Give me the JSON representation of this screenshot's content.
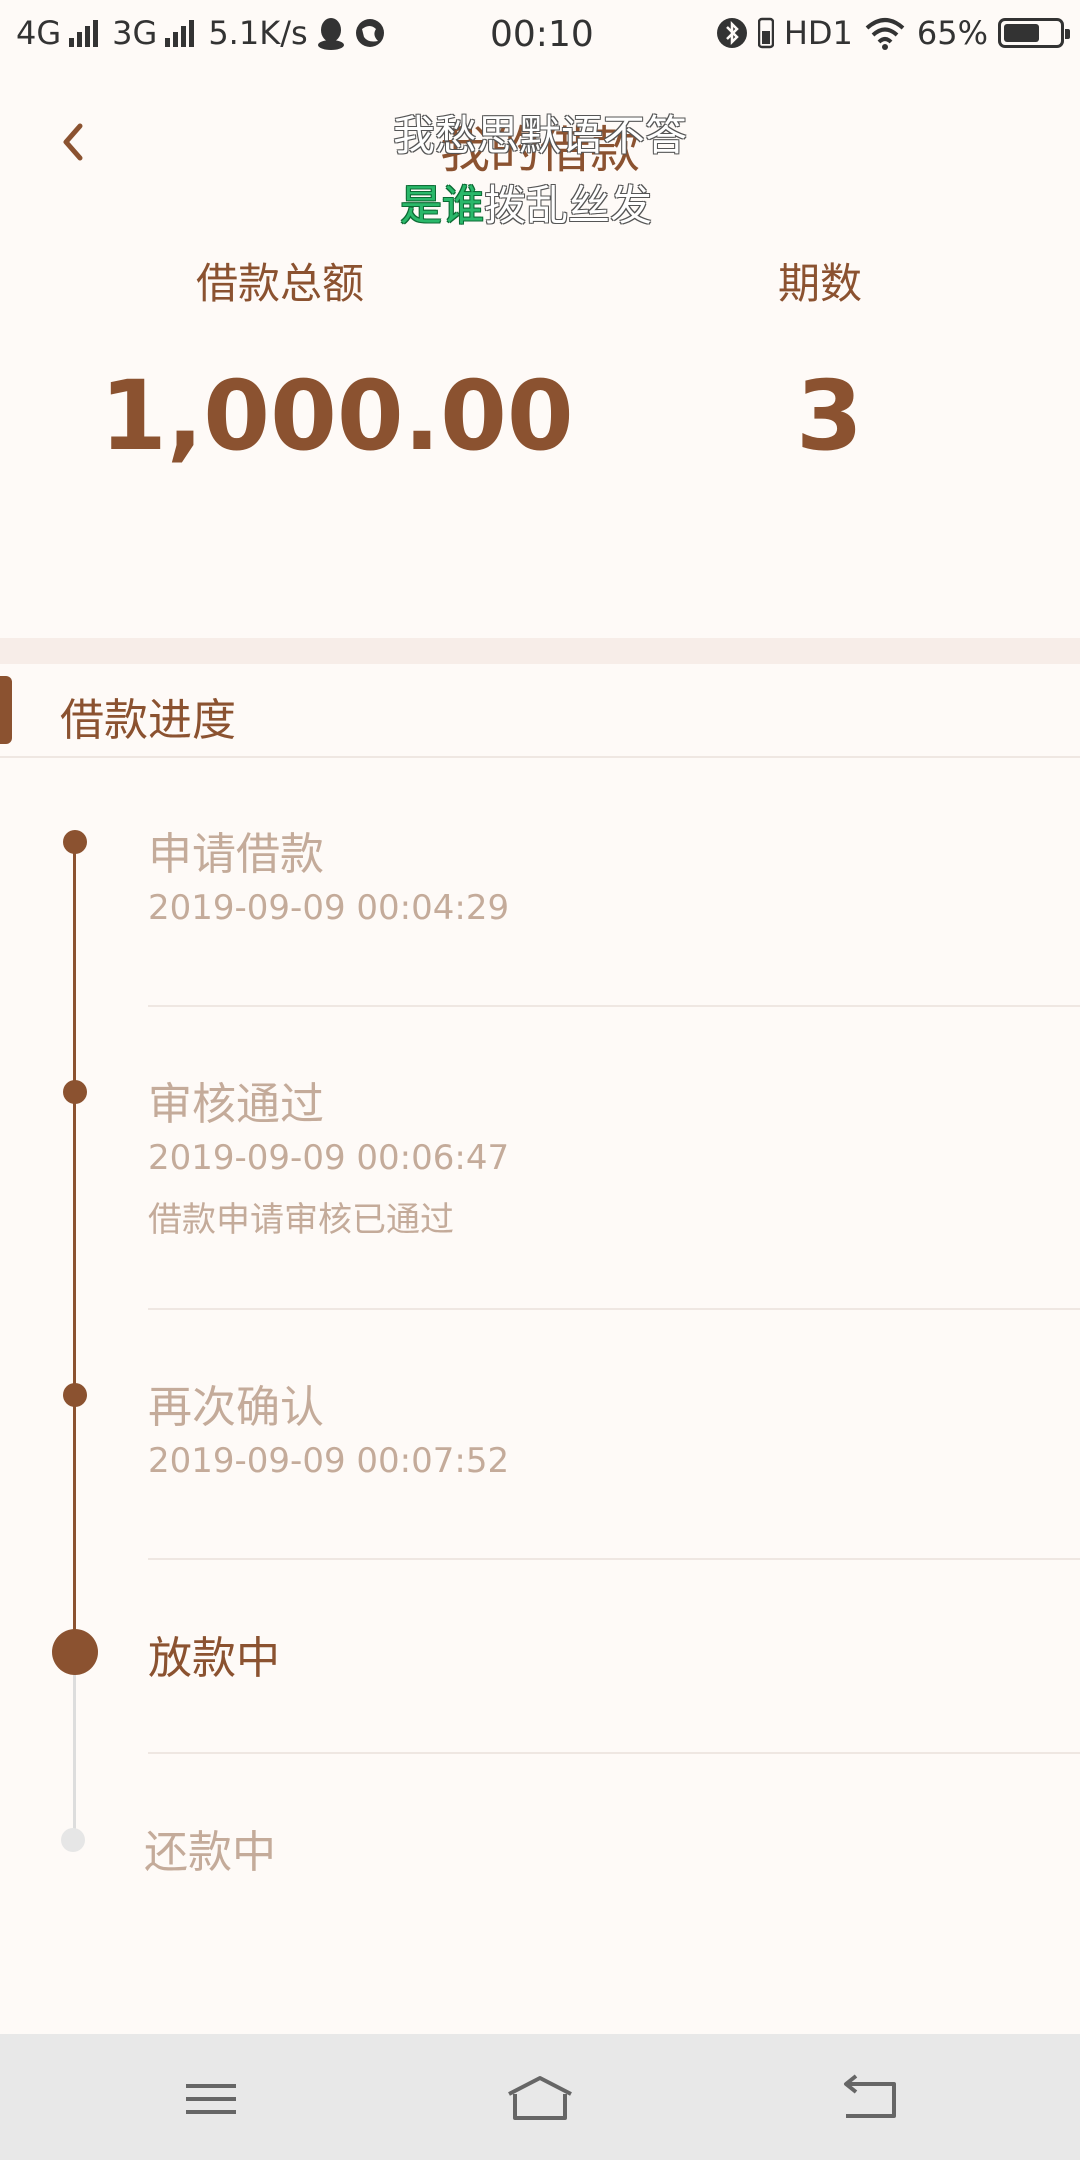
{
  "status_bar": {
    "network1": "4G",
    "network2": "3G",
    "speed": "5.1K/s",
    "time": "00:10",
    "hd": "HD1",
    "battery": "65%",
    "battery_level": 0.65
  },
  "header": {
    "title": "我的借款"
  },
  "lyrics": {
    "line1": "我愁思默语不答",
    "line2_sung": "是谁",
    "line2_rest": "拨乱丝发"
  },
  "summary": {
    "total_label": "借款总额",
    "total_value": "1,000.00",
    "periods_label": "期数",
    "periods_value": "3"
  },
  "progress": {
    "title": "借款进度",
    "steps": [
      {
        "title": "申请借款",
        "time": "2019-09-09 00:04:29",
        "note": ""
      },
      {
        "title": "审核通过",
        "time": "2019-09-09 00:06:47",
        "note": "借款申请审核已通过"
      },
      {
        "title": "再次确认",
        "time": "2019-09-09 00:07:52",
        "note": ""
      },
      {
        "title": "放款中",
        "time": "",
        "note": ""
      },
      {
        "title": "还款中",
        "time": "",
        "note": ""
      }
    ]
  },
  "colors": {
    "accent": "#8b5230",
    "muted": "#c4ab9a",
    "background": "#fefaf7"
  },
  "icons": [
    "back-arrow-icon",
    "menu-icon",
    "home-icon",
    "return-icon",
    "bluetooth-icon",
    "wifi-icon",
    "qq-icon",
    "globe-icon"
  ]
}
